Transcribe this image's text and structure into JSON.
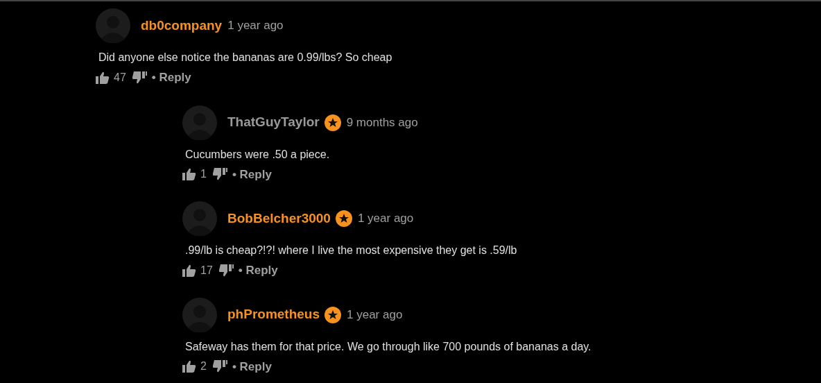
{
  "comments": [
    {
      "username": "db0company",
      "color": "#f7921e",
      "badge": false,
      "time": "1 year ago",
      "text": "Did anyone else notice the bananas are 0.99/lbs? So cheap",
      "likes": "47",
      "reply": "• Reply",
      "children": [
        {
          "username": "ThatGuyTaylor",
          "color": "#9a9a9a",
          "badge": true,
          "time": "9 months ago",
          "text": "Cucumbers were .50 a piece.",
          "likes": "1",
          "reply": "• Reply"
        },
        {
          "username": "BobBelcher3000",
          "color": "#f7921e",
          "badge": true,
          "time": "1 year ago",
          "text": ".99/lb is cheap?!?! where I live the most expensive they get is .59/lb",
          "likes": "17",
          "reply": "• Reply"
        },
        {
          "username": "phPrometheus",
          "color": "#f7921e",
          "badge": true,
          "time": "1 year ago",
          "text": "Safeway has them for that price. We go through like 700 pounds of bananas a day.",
          "likes": "2",
          "reply": "• Reply"
        }
      ]
    }
  ]
}
